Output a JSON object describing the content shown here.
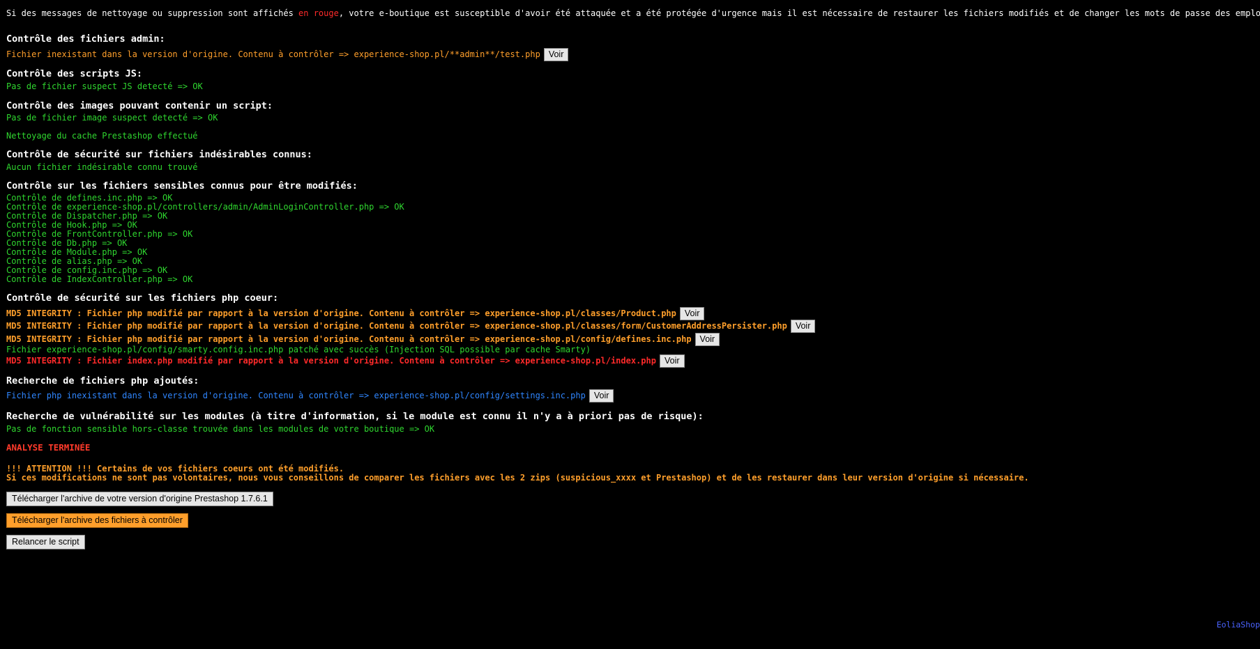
{
  "intro": {
    "before": "Si des messages de nettoyage ou suppression sont affichés ",
    "highlight": "en rouge",
    "after": ", votre e-boutique est susceptible d'avoir été attaquée et a été protégée d'urgence mais il est nécessaire de restaurer les fichiers modifiés et de changer les mots de passe des employés"
  },
  "admin": {
    "heading": "Contrôle des fichiers admin:",
    "message": "Fichier inexistant dans la version d'origine. Contenu à contrôler => experience-shop.pl/**admin**/test.php",
    "button": "Voir"
  },
  "js": {
    "heading": "Contrôle des scripts JS:",
    "message": "Pas de fichier suspect JS detecté => OK"
  },
  "images": {
    "heading": "Contrôle des images pouvant contenir un script:",
    "message": "Pas de fichier image suspect detecté => OK"
  },
  "cache": {
    "message": "Nettoyage du cache Prestashop effectué"
  },
  "unwanted": {
    "heading": "Contrôle de sécurité sur fichiers indésirables connus:",
    "message": "Aucun fichier indésirable connu trouvé"
  },
  "sensitive": {
    "heading": "Contrôle sur les fichiers sensibles connus pour être modifiés:",
    "items": [
      "Contrôle de defines.inc.php => OK",
      "Contrôle de experience-shop.pl/controllers/admin/AdminLoginController.php => OK",
      "Contrôle de Dispatcher.php => OK",
      "Contrôle de Hook.php => OK",
      "Contrôle de FrontController.php => OK",
      "Contrôle de Db.php => OK",
      "Contrôle de Module.php => OK",
      "Contrôle de alias.php => OK",
      "Contrôle de config.inc.php => OK",
      "Contrôle de IndexController.php => OK"
    ]
  },
  "core": {
    "heading": "Contrôle de sécurité sur les fichiers php coeur:",
    "line1": {
      "prefix": "MD5 INTEGRITY : ",
      "text": "Fichier php modifié par rapport à la version d'origine. Contenu à contrôler => experience-shop.pl/classes/Product.php",
      "button": "Voir"
    },
    "line2": {
      "prefix": "MD5 INTEGRITY : ",
      "text": "Fichier php modifié par rapport à la version d'origine. Contenu à contrôler => experience-shop.pl/classes/form/CustomerAddressPersister.php",
      "button": "Voir"
    },
    "line3": {
      "prefix": "MD5 INTEGRITY : ",
      "text": "Fichier php modifié par rapport à la version d'origine. Contenu à contrôler => experience-shop.pl/config/defines.inc.php",
      "button": "Voir"
    },
    "line4": {
      "text": "Fichier experience-shop.pl/config/smarty.config.inc.php patché avec succès (Injection SQL possible par cache Smarty)"
    },
    "line5": {
      "prefix": "MD5 INTEGRITY : ",
      "text": "Fichier index.php modifié par rapport à la version d'origine. Contenu à contrôler => experience-shop.pl/index.php",
      "button": "Voir"
    }
  },
  "added": {
    "heading": "Recherche de fichiers php ajoutés:",
    "message": "Fichier php inexistant dans la version d'origine. Contenu à contrôler => experience-shop.pl/config/settings.inc.php",
    "button": "Voir"
  },
  "vuln": {
    "heading": "Recherche de vulnérabilité sur les modules (à titre d'information, si le module est connu il n'y a à priori pas de risque):",
    "message": "Pas de fonction sensible hors-classe trouvée dans les modules de votre boutique => OK"
  },
  "status": {
    "done": "ANALYSE TERMINÉE",
    "warning1": "!!! ATTENTION !!! Certains de vos fichiers coeurs ont été modifiés.",
    "warning2": "Si ces modifications ne sont pas volontaires, nous vous conseillons de comparer les fichiers avec les 2 zips (suspicious_xxxx et Prestashop) et de les restaurer dans leur version d'origine si nécessaire."
  },
  "buttons": {
    "download_original": "Télécharger l'archive de votre version d'origine Prestashop 1.7.6.1",
    "download_check": "Télécharger l'archive des fichiers à contrôler",
    "rerun": "Relancer le script"
  },
  "footer": {
    "brand": "EoliaShop"
  },
  "colors": {
    "background": "#000000",
    "ok_green": "#2fd62f",
    "warning_orange": "#ff9f2b",
    "alert_red": "#ff2a2a",
    "info_blue": "#2f86ff",
    "link_blue": "#4a63ff"
  }
}
